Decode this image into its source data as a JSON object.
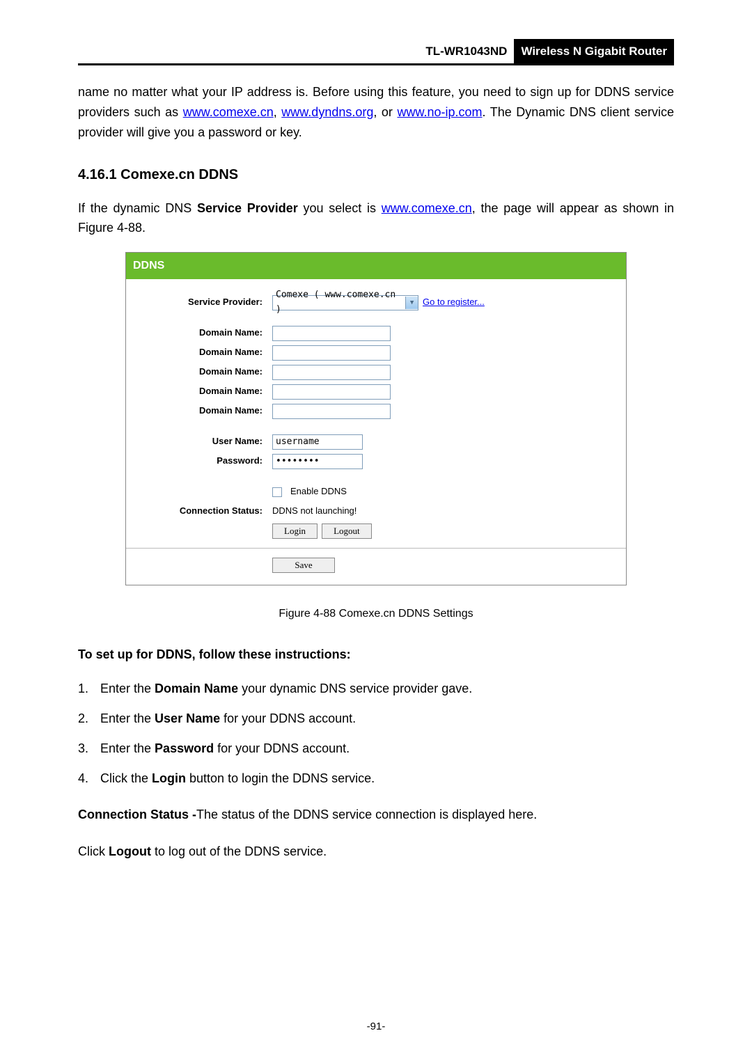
{
  "header": {
    "model": "TL-WR1043ND",
    "product": "Wireless N Gigabit Router"
  },
  "intro": {
    "part1": "name no matter what your IP address is. Before using this feature, you need to sign up for DDNS service providers such as ",
    "link1": "www.comexe.cn",
    "sep1": ", ",
    "link2": "www.dyndns.org",
    "sep2": ", or ",
    "link3": "www.no-ip.com",
    "part2": ". The Dynamic DNS client service provider will give you a password or key."
  },
  "section": {
    "heading": "4.16.1  Comexe.cn DDNS",
    "p_part1": "If the dynamic DNS ",
    "p_bold1": "Service Provider",
    "p_part2": " you select is ",
    "p_link": "www.comexe.cn",
    "p_part3": ", the page will appear as shown in Figure 4-88."
  },
  "figure": {
    "title": "DDNS",
    "labels": {
      "service_provider": "Service Provider:",
      "domain_name": "Domain Name:",
      "user_name": "User Name:",
      "password": "Password:",
      "connection_status": "Connection Status:"
    },
    "values": {
      "provider_select": "Comexe ( www.comexe.cn )",
      "register_link": "Go to register...",
      "username": "username",
      "password_masked": "••••••••",
      "enable_label": "Enable DDNS",
      "status_text": "DDNS not launching!",
      "btn_login": "Login",
      "btn_logout": "Logout",
      "btn_save": "Save"
    },
    "caption": "Figure 4-88 Comexe.cn DDNS Settings"
  },
  "instructions": {
    "heading": "To set up for DDNS, follow these instructions:",
    "items": [
      {
        "num": "1.",
        "pre": "Enter the ",
        "bold": "Domain Name",
        "post": " your dynamic DNS service provider gave."
      },
      {
        "num": "2.",
        "pre": "Enter the ",
        "bold": "User Name",
        "post": " for your DDNS account."
      },
      {
        "num": "3.",
        "pre": "Enter the ",
        "bold": "Password",
        "post": " for your DDNS account."
      },
      {
        "num": "4.",
        "pre": "Click the ",
        "bold": "Login",
        "post": " button to login the DDNS service."
      }
    ]
  },
  "conn_status_line": {
    "bold": "Connection Status -",
    "text": "The status of the DDNS service connection is displayed here."
  },
  "logout_line": {
    "pre": "Click ",
    "bold": "Logout",
    "post": " to log out of the DDNS service."
  },
  "page_number": "-91-"
}
